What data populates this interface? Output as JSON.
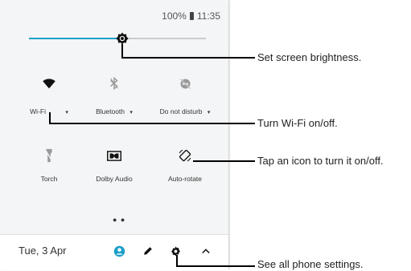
{
  "status": {
    "battery": "100%",
    "time": "11:35"
  },
  "brightness": {
    "level": 0.55
  },
  "tiles_row1": [
    {
      "label": "Wi-Fi",
      "icon": "wifi-icon",
      "caret": "▾"
    },
    {
      "label": "Bluetooth",
      "icon": "bluetooth-icon",
      "caret": "▾"
    },
    {
      "label": "Do not disturb",
      "icon": "do-not-disturb-icon",
      "caret": "▾"
    }
  ],
  "tiles_row2": [
    {
      "label": "Torch",
      "icon": "torch-icon"
    },
    {
      "label": "Dolby Audio",
      "icon": "dolby-icon"
    },
    {
      "label": "Auto-rotate",
      "icon": "auto-rotate-icon"
    }
  ],
  "page_dots": "● ●",
  "bottom": {
    "date": "Tue, 3 Apr"
  },
  "callouts": {
    "brightness": "Set screen brightness.",
    "wifi": "Turn Wi-Fi on/off.",
    "tap_icon": "Tap an icon to turn it on/off.",
    "settings": "See all phone settings."
  },
  "colors": {
    "accent": "#1e9fc9",
    "panel": "#f4f5f6"
  }
}
